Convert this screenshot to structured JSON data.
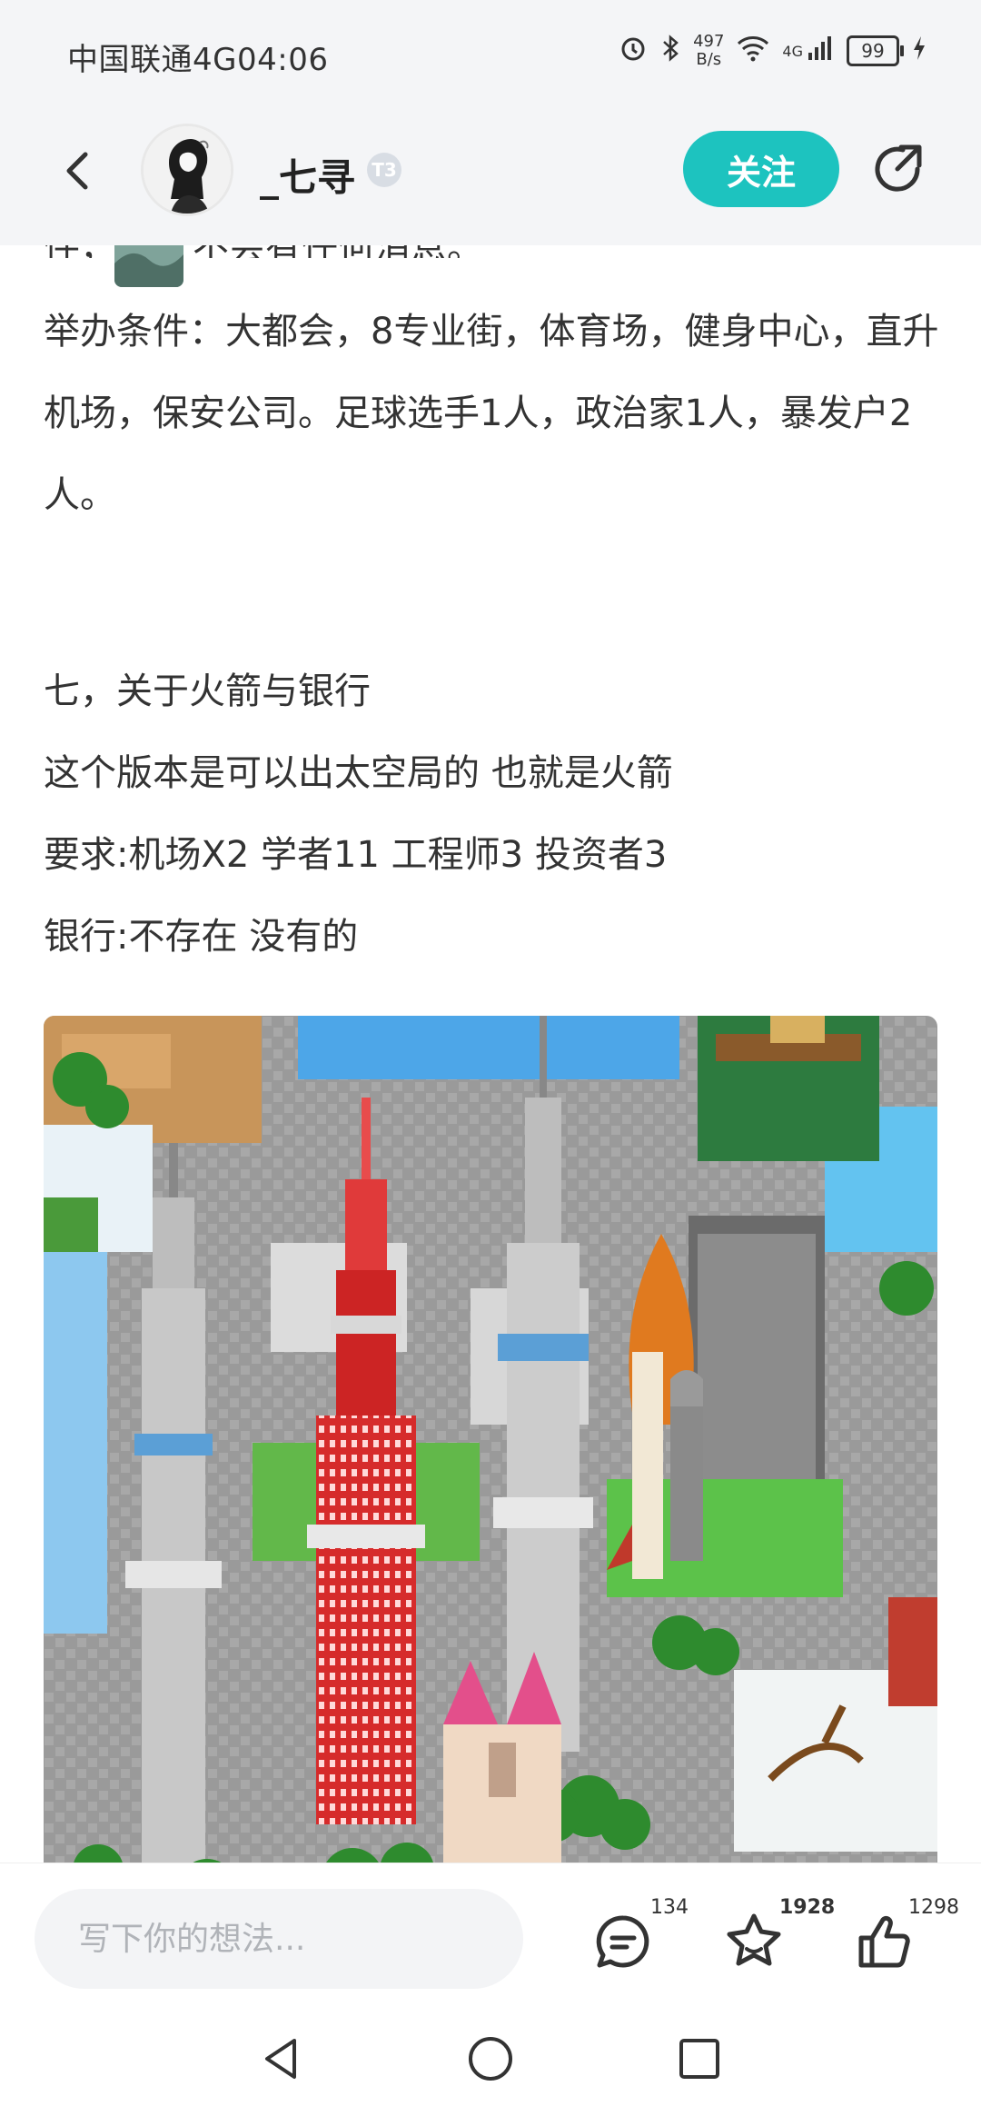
{
  "status_bar": {
    "carrier": "中国联通4G",
    "time": "04:06",
    "net_speed_value": "497",
    "net_speed_unit": "B/s",
    "network": "4G",
    "battery": "99"
  },
  "header": {
    "author_name": "_七寻",
    "level_badge": "T3",
    "follow_label": "关注"
  },
  "post": {
    "partial_line_left": "件，",
    "partial_line_right": "不会有任何消息。",
    "paragraph_1": "举办条件：大都会，8专业街，体育场，健身中心，直升机场，保安公司。足球选手1人，政治家1人，暴发户2人。",
    "heading_7": "七，关于火箭与银行",
    "line_rocket": "这个版本是可以出太空局的 也就是火箭",
    "line_requirements": "要求:机场X2 学者11 工程师3 投资者3",
    "line_bank": "银行:不存在 没有的"
  },
  "bottom_bar": {
    "comment_placeholder": "写下你的想法...",
    "comment_count": "134",
    "favorite_count": "1928",
    "like_count": "1298"
  },
  "colors": {
    "accent": "#1dc3bf",
    "header_bg": "#f4f5f7"
  }
}
